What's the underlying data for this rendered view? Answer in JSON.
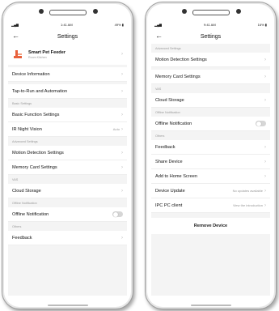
{
  "left": {
    "status": {
      "time": "1:41 AM",
      "battery": "49%"
    },
    "title": "Settings",
    "device": {
      "name": "Smart Pet Feeder",
      "room": "Room Kitchen"
    },
    "rows": {
      "device_info": "Device Information",
      "tap_to_run": "Tap-to-Run and Automation",
      "basic_function": "Basic Function Settings",
      "ir_night": "IR Night Vision",
      "ir_night_value": "Auto",
      "motion_detection": "Motion Detection Settings",
      "memory_card": "Memory Card Settings",
      "cloud_storage": "Cloud Storage",
      "offline_notification": "Offline Notification",
      "feedback": "Feedback"
    },
    "sections": {
      "basic": "Basic Settings",
      "advanced": "Advanced Settings",
      "vas": "VAS",
      "offline": "Offline Notification",
      "others": "Others"
    }
  },
  "right": {
    "status": {
      "time": "9:41 AM",
      "battery": "16%"
    },
    "title": "Settings",
    "rows": {
      "motion_detection": "Motion Detection Settings",
      "memory_card": "Memory Card Settings",
      "cloud_storage": "Cloud Storage",
      "offline_notification": "Offline Notification",
      "feedback": "Feedback",
      "share_device": "Share Device",
      "add_home": "Add to Home Screen",
      "device_update": "Device Update",
      "device_update_value": "No updates available",
      "ipc_client": "IPC PC client",
      "ipc_client_value": "View the introduction",
      "remove_device": "Remove Device"
    },
    "sections": {
      "advanced": "Advanced Settings",
      "vas": "VAS",
      "offline": "Offline Notification",
      "others": "Others"
    }
  },
  "icons": {
    "back": "back-arrow-icon",
    "chevron": "chevron-right-icon",
    "toggle_state": "off"
  }
}
